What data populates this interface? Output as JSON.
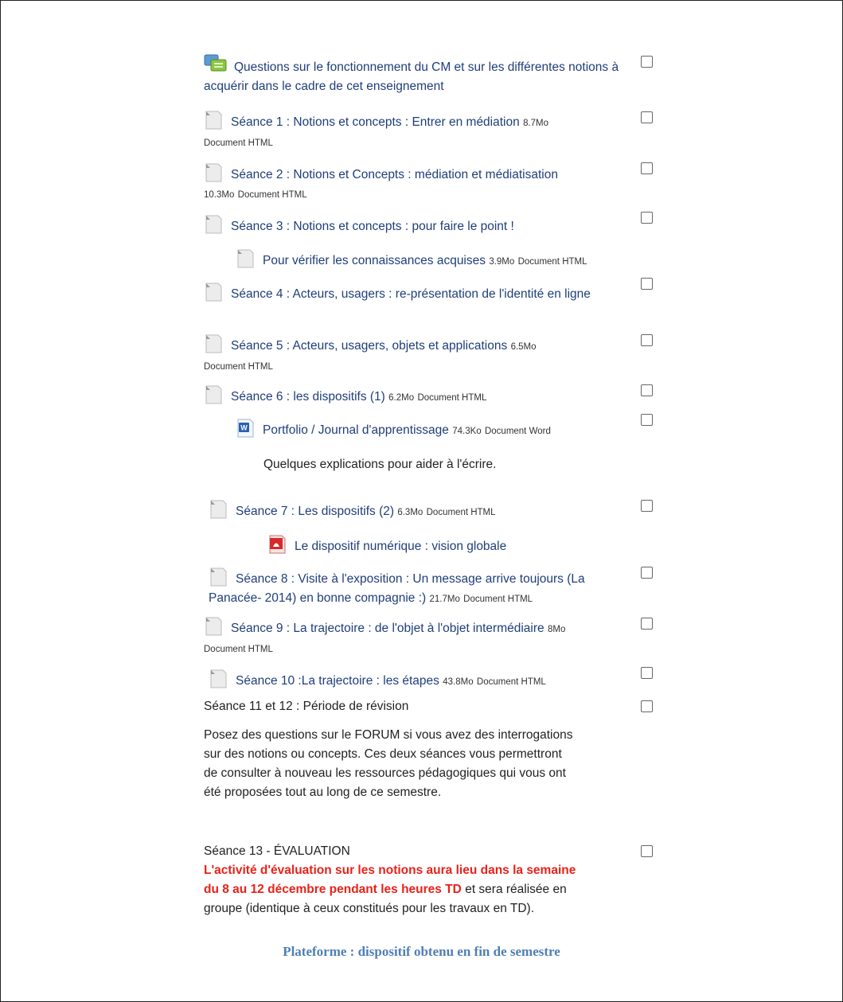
{
  "items": [
    {
      "title": "Questions sur le fonctionnement du CM et sur les différentes notions à acquérir dans le cadre de cet enseignement"
    },
    {
      "title": "Séance 1 : Notions et concepts : Entrer en médiation",
      "size": "8.7Mo",
      "type": "Document HTML"
    },
    {
      "title": "Séance 2 : Notions et Concepts : médiation et médiatisation",
      "size": "10.3Mo",
      "type": "Document HTML"
    },
    {
      "title": "Séance 3 : Notions et concepts : pour faire le point !"
    },
    {
      "title": "Pour vérifier les connaissances acquises",
      "size": "3.9Mo",
      "type": "Document HTML"
    },
    {
      "title": "Séance 4 : Acteurs, usagers : re-présentation de l'identité en ligne"
    },
    {
      "title": "Séance 5 : Acteurs, usagers, objets et applications",
      "size": "6.5Mo",
      "type": "Document HTML"
    },
    {
      "title": "Séance 6 : les dispositifs (1)",
      "size": "6.2Mo",
      "type": "Document HTML"
    },
    {
      "title": "Portfolio / Journal d'apprentissage",
      "size": "74.3Ko",
      "type": "Document Word"
    },
    {
      "title": "Séance 7 : Les dispositifs (2)",
      "size": "6.3Mo",
      "type": "Document HTML"
    },
    {
      "title": "Le dispositif numérique : vision globale"
    },
    {
      "title": "Séance 8 : Visite à l'exposition : Un message arrive toujours (La Panacée- 2014) en bonne compagnie :)",
      "size": "21.7Mo",
      "type": "Document HTML"
    },
    {
      "title": "Séance 9 : La trajectoire : de l'objet à l'objet intermédiaire",
      "size": "8Mo",
      "type": "Document HTML"
    },
    {
      "title": "Séance 10 :La trajectoire : les étapes",
      "size": "43.8Mo",
      "type": "Document HTML"
    }
  ],
  "portfolio_note": "Quelques explications pour aider à l'écrire.",
  "seance11": {
    "title": "Séance 11 et 12 : Période de révision",
    "text": "Posez des questions sur le FORUM si vous avez des interrogations sur des notions ou concepts. Ces deux séances vous permettront de consulter  à nouveau les ressources pédagogiques qui vous ont été proposées tout au long de ce semestre."
  },
  "seance13": {
    "title": "Séance 13 - ÉVALUATION",
    "highlight": "L'activité d'évaluation sur les notions aura lieu dans la semaine du 8 au 12 décembre pendant les heures TD",
    "rest": " et sera réalisée en groupe (identique à ceux constitués pour les travaux en TD)."
  },
  "caption": "Plateforme : dispositif obtenu en fin de semestre",
  "colors": {
    "link": "#1f3e7a",
    "alert": "#e8221a",
    "caption": "#4f7fb5"
  }
}
